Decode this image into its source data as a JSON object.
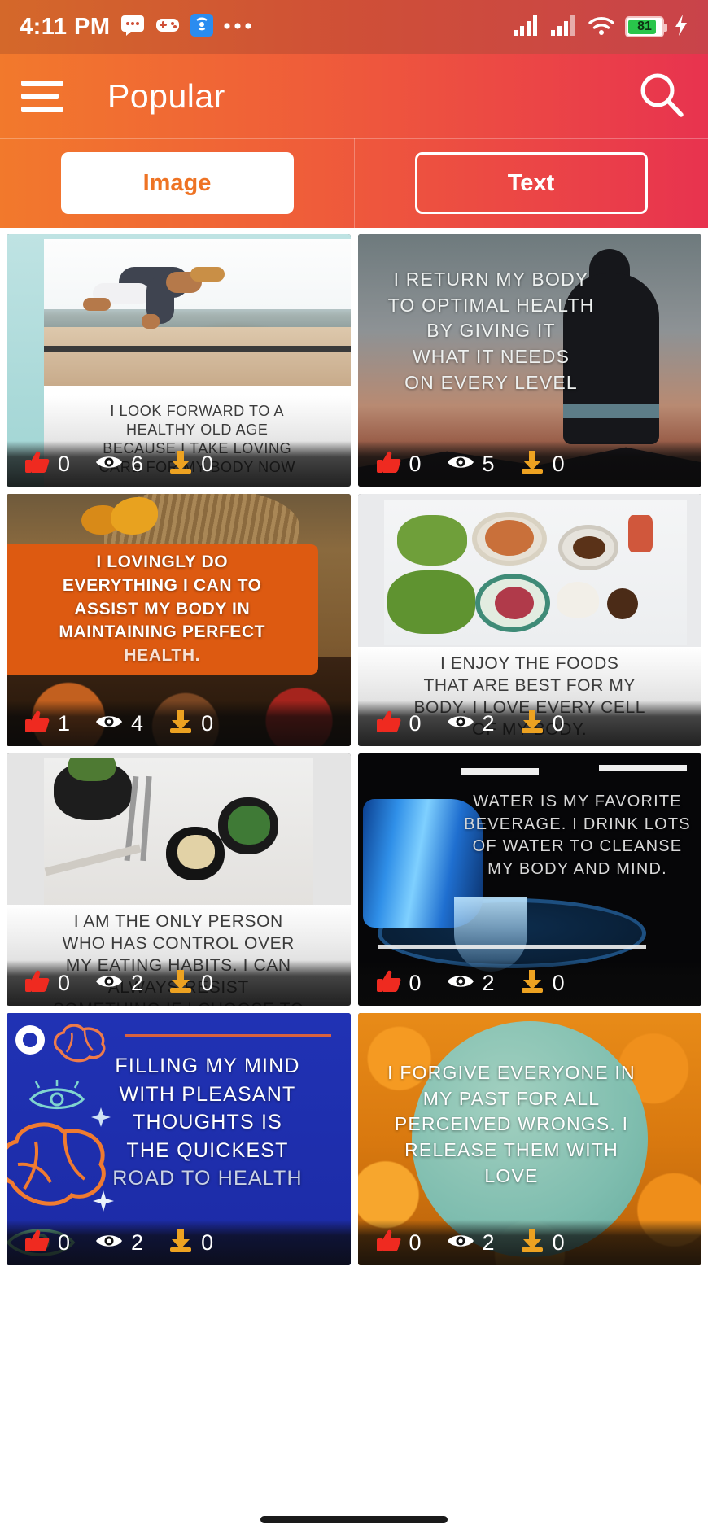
{
  "status_bar": {
    "time": "4:11 PM",
    "icons_left": [
      "message-icon",
      "game-controller-icon",
      "hotspot-icon",
      "more-dots-icon"
    ],
    "icons_right": [
      "signal-1-icon",
      "signal-2-icon",
      "wifi-icon",
      "battery-icon",
      "charging-bolt-icon"
    ],
    "battery_percent": "81"
  },
  "app_bar": {
    "menu_icon": "hamburger-icon",
    "title": "Popular",
    "search_icon": "search-icon"
  },
  "tabs": [
    {
      "label": "Image",
      "active": true
    },
    {
      "label": "Text",
      "active": false
    }
  ],
  "theme": {
    "gradient_start": "#f2792c",
    "gradient_end": "#e8334f",
    "accent_orange": "#ee7324",
    "like_red": "#ef2a20",
    "download_orange": "#eda221",
    "view_white": "#ffffff"
  },
  "stat_icons": {
    "like": "thumbs-up-icon",
    "view": "eye-icon",
    "download": "download-icon"
  },
  "cards": [
    {
      "id": "card-yoga",
      "caption_lines": [
        "I LOOK FORWARD TO A",
        "HEALTHY OLD AGE",
        "BECAUSE I TAKE LOVING",
        "CARE FOR MY BODY NOW"
      ],
      "likes": "0",
      "views": "6",
      "downloads": "0"
    },
    {
      "id": "card-optimal-health",
      "caption_lines": [
        "I RETURN MY BODY",
        "TO OPTIMAL HEALTH",
        "BY GIVING IT",
        "WHAT IT NEEDS",
        "ON EVERY LEVEL"
      ],
      "likes": "0",
      "views": "5",
      "downloads": "0"
    },
    {
      "id": "card-lovingly-do",
      "caption_lines": [
        "I LOVINGLY DO",
        "EVERYTHING I CAN TO",
        "ASSIST MY BODY IN",
        "MAINTAINING PERFECT",
        "HEALTH."
      ],
      "likes": "1",
      "views": "4",
      "downloads": "0"
    },
    {
      "id": "card-enjoy-foods",
      "caption_lines": [
        "I ENJOY THE FOODS",
        "THAT ARE BEST FOR MY",
        "BODY. I LOVE EVERY CELL",
        "OF MY BODY."
      ],
      "likes": "0",
      "views": "2",
      "downloads": "0"
    },
    {
      "id": "card-eating-habits",
      "caption_lines": [
        "I AM THE ONLY PERSON",
        "WHO HAS CONTROL OVER",
        "MY EATING HABITS. I CAN",
        "ALWAYS RESIST",
        "SOMETHING IF I CHOOSE TO"
      ],
      "likes": "0",
      "views": "2",
      "downloads": "0"
    },
    {
      "id": "card-water",
      "caption_lines": [
        "WATER IS MY  FAVORITE",
        "BEVERAGE. I DRINK LOTS",
        "OF WATER TO CLEANSE",
        "MY BODY AND MIND."
      ],
      "likes": "0",
      "views": "2",
      "downloads": "0"
    },
    {
      "id": "card-pleasant-thoughts",
      "caption_lines": [
        "FILLING MY MIND",
        "WITH PLEASANT",
        "THOUGHTS IS",
        "THE QUICKEST",
        "ROAD TO HEALTH"
      ],
      "likes": "0",
      "views": "2",
      "downloads": "0"
    },
    {
      "id": "card-forgive",
      "caption_lines": [
        "I FORGIVE EVERYONE IN",
        "MY PAST FOR ALL",
        "PERCEIVED WRONGS. I",
        "RELEASE THEM WITH LOVE"
      ],
      "likes": "0",
      "views": "2",
      "downloads": "0"
    }
  ],
  "home_indicator": "home-pill"
}
